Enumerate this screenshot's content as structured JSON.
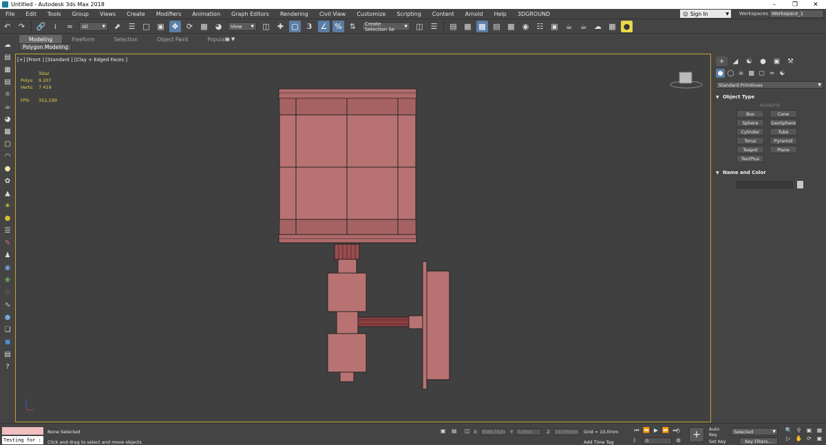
{
  "window": {
    "title": "Untitled - Autodesk 3ds Max 2018",
    "minimize": "–",
    "restore": "❐",
    "close": "✕"
  },
  "menu": [
    "File",
    "Edit",
    "Tools",
    "Group",
    "Views",
    "Create",
    "Modifiers",
    "Animation",
    "Graph Editors",
    "Rendering",
    "Civil View",
    "Customize",
    "Scripting",
    "Content",
    "Arnold",
    "Help",
    "3DGROUND"
  ],
  "account": {
    "sign_in": "Sign In",
    "workspaces_label": "Workspaces:",
    "workspace": "Workspace_1"
  },
  "toolbar": {
    "selection_filter": "All",
    "reference_coord": "View",
    "named_selection": "Create Selection Se",
    "snap_label": "3"
  },
  "ribbon": {
    "tabs": [
      "Modeling",
      "Freeform",
      "Selection",
      "Object Paint",
      "Populate"
    ],
    "active_tab": "Modeling",
    "subpanel": "Polygon Modeling"
  },
  "viewport": {
    "label": "[+] [Front ] [Standard ] [Clay + Edged Faces ]",
    "stats": {
      "total": "Total",
      "polys_label": "Polys:",
      "polys": "9 207",
      "verts_label": "Verts:",
      "verts": "7 419",
      "fps_label": "FPS:",
      "fps": "352,199"
    },
    "accent_color": "#c8a42d",
    "model_color": "#b06a6a"
  },
  "command_panel": {
    "category": "Standard Primitives",
    "object_type_title": "Object Type",
    "autogrid": "AutoGrid",
    "primitives": [
      "Box",
      "Cone",
      "Sphere",
      "GeoSphere",
      "Cylinder",
      "Tube",
      "Torus",
      "Pyramid",
      "Teapot",
      "Plane",
      "TextPlus"
    ],
    "name_color_title": "Name and Color"
  },
  "status": {
    "maxscript_text": "Testing for :",
    "selection": "None Selected",
    "prompt": "Click and drag to select and move objects",
    "x_label": "X:",
    "x_value": "8086,582m",
    "y_label": "Y:",
    "y_value": "0,0mm",
    "z_label": "Z:",
    "z_value": "10,039mm",
    "grid": "Grid = 10,0mm",
    "add_time_tag": "Add Time Tag",
    "frame": "0",
    "auto_key": "Auto Key",
    "set_key": "Set Key",
    "key_mode": "Selected",
    "key_filters": "Key Filters..."
  }
}
